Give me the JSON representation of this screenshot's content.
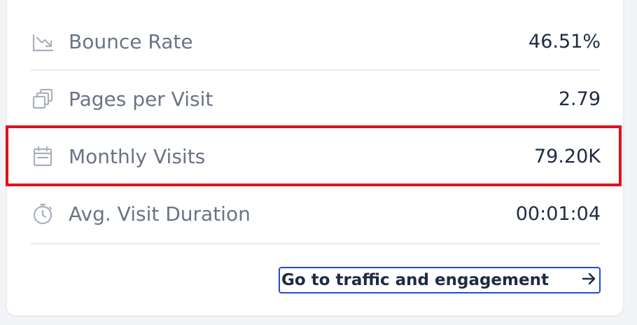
{
  "metrics": [
    {
      "label": "Bounce Rate",
      "value": "46.51%",
      "icon": "trend-down-icon"
    },
    {
      "label": "Pages per Visit",
      "value": "2.79",
      "icon": "pages-icon"
    },
    {
      "label": "Monthly Visits",
      "value": "79.20K",
      "icon": "calendar-icon"
    },
    {
      "label": "Avg. Visit Duration",
      "value": "00:01:04",
      "icon": "stopwatch-icon"
    }
  ],
  "cta": {
    "label": "Go to traffic and engagement",
    "icon": "arrow-right-icon"
  },
  "colors": {
    "highlight": "#e0111b",
    "link_border": "#1d4ed8",
    "value_text": "#1f2a44",
    "label_text": "#6b7386"
  }
}
